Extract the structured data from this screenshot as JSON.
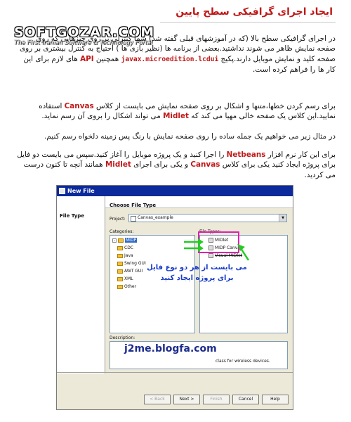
{
  "header": {
    "title": "ایجاد اجرای گرافیکی سطح پایین"
  },
  "watermark": {
    "logo": "SOFTGOZAR.COM",
    "tagline": "The First Iranian Software & Technology Portal"
  },
  "body": {
    "p1_a": "در اجرای گرافیکی سطح بالا (که در آموزشهای قبلی گفته شد) شما کنترلی بر روی چیزهایی که روی صفحه نمایش ظاهر می شوند نداشتید.بعضی از برنامه ها (نظیر بازی ها ) احتیاج به کنترل بیشتری بر روی صفحه کلید و نمایش موبایل دارند.پکیج ",
    "p1_code": "javax.microedition.lcdui",
    "p1_b": " همچنین ",
    "p1_api": "API",
    "p1_c": " های لازم برای این کار ها را فراهم کرده است.",
    "p2_a": "برای رسم کردن خطها،متنها و اشکال بر روی صفحه نمایش می بایست از کلاس ",
    "p2_canvas": "Canvas",
    "p2_b": " استفاده نمایید.این کلاس یک صفحه خالی مهیا می کند که ",
    "p2_midlet": "Midlet",
    "p2_c": " می تواند اشکال را بروی آن رسم نماید.",
    "p3": "در مثال زیر می خواهیم یک جمله ساده را روی صفحه نمایش با رنگ پس زمینه دلخواه رسم کنیم.",
    "p4_a": "برای این کار نرم افزار ",
    "p4_netbeans": "Netbeans",
    "p4_b": " را اجرا کنید و یک پروژه موبایل را آغاز کنید.سپس می بایست دو فایل برای پروژه ایجاد کنید یکی برای کلاس ",
    "p4_canvas": "Canvas",
    "p4_c": " و یکی برای اجرای ",
    "p4_midlet": "Midlet",
    "p4_d": " همانند آنچه تا کنون درست می کردید."
  },
  "dialog": {
    "title": "New File",
    "left_step": "File Type",
    "header": "Choose File Type",
    "project_label": "Project:",
    "project_value": "Canvas_example",
    "categories_label": "Categories:",
    "file_types_label": "File Types:",
    "categories": [
      "MIDP",
      "CDC",
      "Java",
      "Swing GUI",
      "AWT GUI",
      "XML",
      "Other"
    ],
    "file_types": [
      "MIDlet",
      "MIDP Canvas",
      "Visual MIDlet"
    ],
    "description_label": "Description:",
    "description_text": "class for wireless devices.",
    "watermark_blog": "j2me.blogfa.com",
    "buttons": {
      "back": "< Back",
      "next": "Next >",
      "finish": "Finish",
      "cancel": "Cancel",
      "help": "Help"
    }
  },
  "annotation": {
    "text": "می بایست از هر دو نوع فایل برای پروژه ایجاد کنید",
    "color": "#1a3dc8",
    "arrow_color": "#22cc22",
    "box_color": "#e020b0"
  },
  "colors": {
    "title": "#c01818",
    "highlight": "#c01818",
    "dialog_titlebar": "#0c2a9c"
  }
}
